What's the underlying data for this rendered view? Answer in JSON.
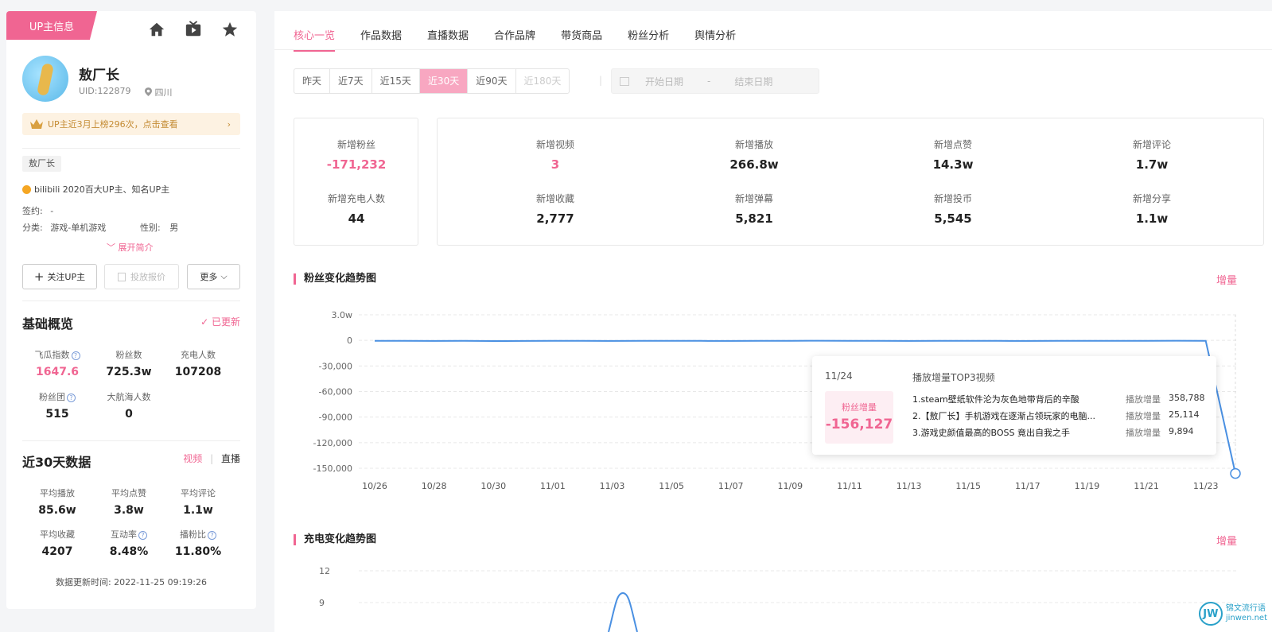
{
  "profile": {
    "tag": "UP主信息",
    "name": "敖厂长",
    "uid": "UID:122879",
    "location": "四川",
    "banner": "UP主近3月上榜296次，点击查看",
    "chip": "敖厂长",
    "honor": "bilibili 2020百大UP主、知名UP主",
    "sign_label": "签约:",
    "sign_value": "-",
    "category_label": "分类:",
    "category_value": "游戏-单机游戏",
    "gender_label": "性别:",
    "gender_value": "男",
    "expand": "展开简介",
    "follow_btn": "关注UP主",
    "quote_btn": "投放报价",
    "more_btn": "更多"
  },
  "basic": {
    "title": "基础概览",
    "updated": "已更新",
    "stats": [
      {
        "label": "飞瓜指数",
        "value": "1647.6"
      },
      {
        "label": "粉丝数",
        "value": "725.3w"
      },
      {
        "label": "充电人数",
        "value": "107208"
      },
      {
        "label": "粉丝团",
        "value": "515"
      },
      {
        "label": "大航海人数",
        "value": "0"
      }
    ]
  },
  "recent": {
    "title": "近30天数据",
    "switch_video": "视频",
    "switch_live": "直播",
    "stats": [
      {
        "label": "平均播放",
        "value": "85.6w"
      },
      {
        "label": "平均点赞",
        "value": "3.8w"
      },
      {
        "label": "平均评论",
        "value": "1.1w"
      },
      {
        "label": "平均收藏",
        "value": "4207"
      },
      {
        "label": "互动率",
        "value": "8.48%"
      },
      {
        "label": "播粉比",
        "value": "11.80%"
      }
    ],
    "update_time": "数据更新时间:   2022-11-25 09:19:26"
  },
  "tabs": [
    "核心一览",
    "作品数据",
    "直播数据",
    "合作品牌",
    "带货商品",
    "粉丝分析",
    "舆情分析"
  ],
  "ranges": [
    "昨天",
    "近7天",
    "近15天",
    "近30天",
    "近90天",
    "近180天"
  ],
  "date_start": "开始日期",
  "date_sep": "-",
  "date_end": "结束日期",
  "kpis": {
    "fans_new": {
      "label": "新增粉丝",
      "value": "-171,232"
    },
    "charge_new": {
      "label": "新增充电人数",
      "value": "44"
    },
    "grid": [
      {
        "label": "新增视频",
        "value": "3"
      },
      {
        "label": "新增播放",
        "value": "266.8w"
      },
      {
        "label": "新增点赞",
        "value": "14.3w"
      },
      {
        "label": "新增评论",
        "value": "1.7w"
      },
      {
        "label": "新增收藏",
        "value": "2,777"
      },
      {
        "label": "新增弹幕",
        "value": "5,821"
      },
      {
        "label": "新增投币",
        "value": "5,545"
      },
      {
        "label": "新增分享",
        "value": "1.1w"
      }
    ]
  },
  "fans_chart": {
    "title": "粉丝变化趋势图",
    "mode": "增量"
  },
  "charge_chart": {
    "title": "充电变化趋势图",
    "mode": "增量"
  },
  "tooltip": {
    "date": "11/24",
    "top_label": "播放增量TOP3视频",
    "fans_label": "粉丝增量",
    "fans_value": "-156,127",
    "videos": [
      {
        "title": "1.steam壁纸软件沦为灰色地带背后的辛酸",
        "label": "播放增量",
        "value": "358,788"
      },
      {
        "title": "2.【敖厂长】手机游戏在逐渐占领玩家的电脑...",
        "label": "播放增量",
        "value": "25,114"
      },
      {
        "title": "3.游戏史颜值最高的BOSS 竟出自我之手",
        "label": "播放增量",
        "value": "9,894"
      }
    ]
  },
  "watermark": {
    "logo": "JW",
    "line1": "锦文流行语",
    "line2": "jinwen.net"
  },
  "chart_data": [
    {
      "type": "line",
      "title": "粉丝变化趋势图",
      "y_ticks": [
        "3.0w",
        "0",
        "-30,000",
        "-60,000",
        "-90,000",
        "-120,000",
        "-150,000"
      ],
      "ylim": [
        -150000,
        30000
      ],
      "x_ticks": [
        "10/26",
        "10/28",
        "10/30",
        "11/01",
        "11/03",
        "11/05",
        "11/07",
        "11/09",
        "11/11",
        "11/13",
        "11/15",
        "11/17",
        "11/19",
        "11/21",
        "11/23"
      ],
      "x": [
        "10/26",
        "10/27",
        "10/28",
        "10/29",
        "10/30",
        "10/31",
        "11/01",
        "11/02",
        "11/03",
        "11/04",
        "11/05",
        "11/06",
        "11/07",
        "11/08",
        "11/09",
        "11/10",
        "11/11",
        "11/12",
        "11/13",
        "11/14",
        "11/15",
        "11/16",
        "11/17",
        "11/18",
        "11/19",
        "11/20",
        "11/21",
        "11/22",
        "11/23",
        "11/24"
      ],
      "values": [
        -500,
        -600,
        -700,
        -600,
        -800,
        -700,
        -600,
        -500,
        -700,
        -600,
        -500,
        -600,
        -700,
        -600,
        -500,
        -400,
        -600,
        -500,
        -700,
        -600,
        -500,
        -600,
        -700,
        -600,
        -500,
        -600,
        -500,
        -400,
        -600,
        -156127
      ],
      "color": "#4a90e2"
    },
    {
      "type": "line",
      "title": "充电变化趋势图",
      "y_ticks": [
        "12",
        "9"
      ],
      "ylim": [
        0,
        12
      ],
      "color": "#4a90e2"
    }
  ]
}
